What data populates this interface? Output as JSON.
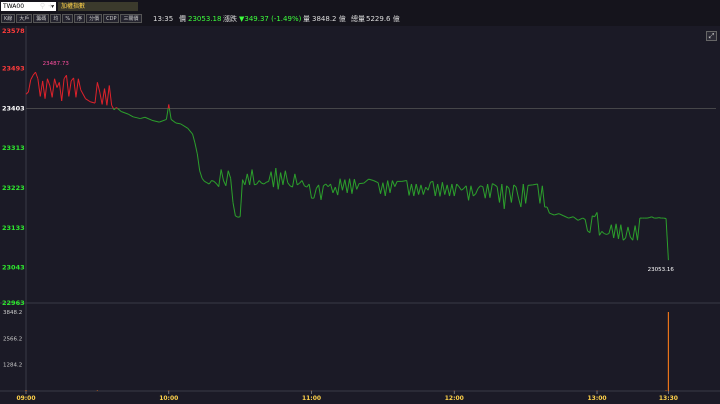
{
  "toolbar": {
    "symbol_input": "TWA00",
    "symbol_name": "加權指數",
    "buttons": [
      "K線",
      "大戶",
      "籌碼",
      "均",
      "%",
      "序",
      "分價",
      "CDP",
      "三關價"
    ],
    "time": "13:35",
    "price_label": "價",
    "price_value": "23053.18",
    "change_label": "漲跌",
    "change_value": "▼349.37 (-1.49%)",
    "volume_label": "量",
    "volume_value": "3848.2 億",
    "total_label": "總量",
    "total_value": "5229.6 億"
  },
  "colors": {
    "background": "#1b1a26",
    "up": "#e0222b",
    "down": "#2ca02c",
    "flat": "#c9a227",
    "volume": "#e8731a",
    "axis_up_text": "#ff3b3b",
    "axis_down_text": "#2ee82e",
    "reference_line": "#555555",
    "change_text": "#3dff3d"
  },
  "chart_data": {
    "type": "line",
    "reference_price": 23403,
    "price_ylim": [
      22963,
      23578
    ],
    "y_ticks": [
      "23578",
      "23493",
      "23403",
      "23313",
      "23223",
      "23133",
      "23043",
      "22963"
    ],
    "x_ticks": [
      "09:00",
      "10:00",
      "11:00",
      "12:00",
      "13:00",
      "13:30"
    ],
    "high_label": "23487.73",
    "last_label": "23053.16",
    "volume_ticks": [
      "3848.2",
      "2566.2",
      "1284.2"
    ],
    "volume_ylim": [
      0,
      3848.2
    ],
    "series": [
      {
        "values": [
          [
            "09:00",
            23435
          ],
          [
            "09:01",
            23440
          ],
          [
            "09:02",
            23468
          ],
          [
            "09:03",
            23478
          ],
          [
            "09:04",
            23485
          ],
          [
            "09:05",
            23470
          ],
          [
            "09:06",
            23430
          ],
          [
            "09:07",
            23465
          ],
          [
            "09:08",
            23425
          ],
          [
            "09:09",
            23470
          ],
          [
            "09:10",
            23455
          ],
          [
            "09:11",
            23428
          ],
          [
            "09:12",
            23470
          ],
          [
            "09:13",
            23450
          ],
          [
            "09:14",
            23462
          ],
          [
            "09:15",
            23420
          ],
          [
            "09:16",
            23470
          ],
          [
            "09:17",
            23478
          ],
          [
            "09:18",
            23430
          ],
          [
            "09:19",
            23465
          ],
          [
            "09:20",
            23472
          ],
          [
            "09:21",
            23428
          ],
          [
            "09:22",
            23470
          ],
          [
            "09:23",
            23445
          ],
          [
            "09:25",
            23425
          ],
          [
            "09:27",
            23418
          ],
          [
            "09:29",
            23415
          ],
          [
            "09:30",
            23462
          ],
          [
            "09:31",
            23440
          ],
          [
            "09:32",
            23412
          ],
          [
            "09:33",
            23448
          ],
          [
            "09:34",
            23410
          ],
          [
            "09:35",
            23455
          ],
          [
            "09:36",
            23410
          ],
          [
            "09:37",
            23400
          ],
          [
            "09:38",
            23405
          ],
          [
            "09:40",
            23396
          ],
          [
            "09:43",
            23390
          ],
          [
            "09:45",
            23384
          ],
          [
            "09:48",
            23380
          ],
          [
            "09:50",
            23383
          ],
          [
            "09:53",
            23376
          ],
          [
            "09:56",
            23372
          ],
          [
            "09:59",
            23378
          ],
          [
            "10:00",
            23412
          ],
          [
            "10:01",
            23378
          ],
          [
            "10:03",
            23370
          ],
          [
            "10:05",
            23368
          ],
          [
            "10:08",
            23358
          ],
          [
            "10:10",
            23345
          ],
          [
            "10:11",
            23325
          ],
          [
            "10:12",
            23300
          ],
          [
            "10:13",
            23262
          ],
          [
            "10:14",
            23245
          ],
          [
            "10:15",
            23238
          ],
          [
            "10:16",
            23235
          ],
          [
            "10:17",
            23232
          ],
          [
            "10:18",
            23240
          ],
          [
            "10:19",
            23238
          ],
          [
            "10:20",
            23233
          ],
          [
            "10:21",
            23226
          ],
          [
            "10:22",
            23265
          ],
          [
            "10:23",
            23240
          ],
          [
            "10:24",
            23228
          ],
          [
            "10:25",
            23262
          ],
          [
            "10:26",
            23245
          ],
          [
            "10:27",
            23190
          ],
          [
            "10:28",
            23160
          ],
          [
            "10:29",
            23157
          ],
          [
            "10:30",
            23158
          ],
          [
            "10:31",
            23242
          ],
          [
            "10:32",
            23230
          ],
          [
            "10:33",
            23255
          ],
          [
            "10:34",
            23230
          ],
          [
            "10:35",
            23265
          ],
          [
            "10:36",
            23230
          ],
          [
            "10:37",
            23232
          ],
          [
            "10:38",
            23240
          ],
          [
            "10:39",
            23234
          ],
          [
            "10:40",
            23232
          ],
          [
            "10:41",
            23236
          ],
          [
            "10:42",
            23238
          ],
          [
            "10:43",
            23260
          ],
          [
            "10:44",
            23225
          ],
          [
            "10:45",
            23268
          ],
          [
            "10:46",
            23220
          ],
          [
            "10:47",
            23258
          ],
          [
            "10:48",
            23230
          ],
          [
            "10:49",
            23262
          ],
          [
            "10:50",
            23235
          ],
          [
            "10:51",
            23228
          ],
          [
            "10:52",
            23225
          ],
          [
            "10:53",
            23255
          ],
          [
            "10:54",
            23230
          ],
          [
            "10:55",
            23234
          ],
          [
            "10:56",
            23240
          ],
          [
            "10:57",
            23228
          ],
          [
            "10:58",
            23225
          ],
          [
            "10:59",
            23232
          ],
          [
            "11:00",
            23200
          ],
          [
            "11:01",
            23200
          ],
          [
            "11:02",
            23222
          ],
          [
            "11:03",
            23230
          ],
          [
            "11:04",
            23196
          ],
          [
            "11:05",
            23228
          ],
          [
            "11:06",
            23232
          ],
          [
            "11:07",
            23226
          ],
          [
            "11:08",
            23232
          ],
          [
            "11:09",
            23212
          ],
          [
            "11:10",
            23225
          ],
          [
            "11:11",
            23207
          ],
          [
            "11:12",
            23244
          ],
          [
            "11:13",
            23218
          ],
          [
            "11:14",
            23242
          ],
          [
            "11:15",
            23212
          ],
          [
            "11:16",
            23244
          ],
          [
            "11:17",
            23210
          ],
          [
            "11:18",
            23243
          ],
          [
            "11:19",
            23220
          ],
          [
            "11:20",
            23233
          ],
          [
            "11:22",
            23234
          ],
          [
            "11:24",
            23243
          ],
          [
            "11:26",
            23240
          ],
          [
            "11:28",
            23235
          ],
          [
            "11:29",
            23210
          ],
          [
            "11:30",
            23235
          ],
          [
            "11:31",
            23205
          ],
          [
            "11:32",
            23240
          ],
          [
            "11:33",
            23212
          ],
          [
            "11:34",
            23240
          ],
          [
            "11:35",
            23226
          ],
          [
            "11:36",
            23238
          ],
          [
            "11:38",
            23238
          ],
          [
            "11:40",
            23240
          ],
          [
            "11:41",
            23206
          ],
          [
            "11:42",
            23232
          ],
          [
            "11:43",
            23205
          ],
          [
            "11:44",
            23232
          ],
          [
            "11:45",
            23208
          ],
          [
            "11:46",
            23230
          ],
          [
            "11:47",
            23208
          ],
          [
            "11:48",
            23225
          ],
          [
            "11:49",
            23218
          ],
          [
            "11:50",
            23236
          ],
          [
            "11:51",
            23238
          ],
          [
            "11:52",
            23205
          ],
          [
            "11:53",
            23232
          ],
          [
            "11:54",
            23204
          ],
          [
            "11:55",
            23236
          ],
          [
            "11:56",
            23208
          ],
          [
            "11:57",
            23230
          ],
          [
            "11:58",
            23205
          ],
          [
            "11:59",
            23232
          ],
          [
            "12:00",
            23205
          ],
          [
            "12:01",
            23232
          ],
          [
            "12:02",
            23226
          ],
          [
            "12:03",
            23218
          ],
          [
            "12:04",
            23222
          ],
          [
            "12:05",
            23228
          ],
          [
            "12:06",
            23195
          ],
          [
            "12:07",
            23228
          ],
          [
            "12:08",
            23205
          ],
          [
            "12:09",
            23210
          ],
          [
            "12:10",
            23222
          ],
          [
            "12:11",
            23228
          ],
          [
            "12:12",
            23226
          ],
          [
            "12:13",
            23200
          ],
          [
            "12:14",
            23232
          ],
          [
            "12:15",
            23201
          ],
          [
            "12:16",
            23233
          ],
          [
            "12:17",
            23230
          ],
          [
            "12:18",
            23226
          ],
          [
            "12:19",
            23190
          ],
          [
            "12:20",
            23232
          ],
          [
            "12:21",
            23176
          ],
          [
            "12:22",
            23228
          ],
          [
            "12:23",
            23222
          ],
          [
            "12:24",
            23190
          ],
          [
            "12:25",
            23230
          ],
          [
            "12:26",
            23225
          ],
          [
            "12:27",
            23200
          ],
          [
            "12:28",
            23180
          ],
          [
            "12:29",
            23232
          ],
          [
            "12:30",
            23188
          ],
          [
            "12:31",
            23229
          ],
          [
            "12:33",
            23230
          ],
          [
            "12:35",
            23232
          ],
          [
            "12:36",
            23188
          ],
          [
            "12:37",
            23228
          ],
          [
            "12:38",
            23180
          ],
          [
            "12:39",
            23180
          ],
          [
            "12:40",
            23166
          ],
          [
            "12:42",
            23162
          ],
          [
            "12:44",
            23165
          ],
          [
            "12:46",
            23160
          ],
          [
            "12:48",
            23155
          ],
          [
            "12:50",
            23158
          ],
          [
            "12:52",
            23150
          ],
          [
            "12:54",
            23155
          ],
          [
            "12:55",
            23152
          ],
          [
            "12:56",
            23126
          ],
          [
            "12:57",
            23122
          ],
          [
            "12:58",
            23160
          ],
          [
            "12:59",
            23158
          ],
          [
            "13:00",
            23168
          ],
          [
            "13:01",
            23116
          ],
          [
            "13:02",
            23125
          ],
          [
            "13:03",
            23120
          ],
          [
            "13:04",
            23118
          ],
          [
            "13:05",
            23120
          ],
          [
            "13:06",
            23140
          ],
          [
            "13:07",
            23110
          ],
          [
            "13:08",
            23142
          ],
          [
            "13:09",
            23108
          ],
          [
            "13:10",
            23140
          ],
          [
            "13:11",
            23105
          ],
          [
            "13:12",
            23110
          ],
          [
            "13:13",
            23135
          ],
          [
            "13:14",
            23112
          ],
          [
            "13:15",
            23105
          ],
          [
            "13:16",
            23138
          ],
          [
            "13:17",
            23105
          ],
          [
            "13:18",
            23155
          ],
          [
            "13:19",
            23155
          ],
          [
            "13:20",
            23155
          ],
          [
            "13:21",
            23155
          ],
          [
            "13:22",
            23156
          ],
          [
            "13:23",
            23158
          ],
          [
            "13:24",
            23155
          ],
          [
            "13:25",
            23155
          ],
          [
            "13:26",
            23156
          ],
          [
            "13:27",
            23155
          ],
          [
            "13:28",
            23155
          ],
          [
            "13:29",
            23154
          ],
          [
            "13:30",
            23060
          ]
        ]
      }
    ],
    "volume_values": [
      [
        "09:00",
        40
      ],
      [
        "09:30",
        25
      ],
      [
        "10:00",
        20
      ],
      [
        "11:00",
        15
      ],
      [
        "12:00",
        15
      ],
      [
        "13:00",
        20
      ],
      [
        "13:29",
        30
      ],
      [
        "13:30",
        3848.2
      ]
    ]
  }
}
